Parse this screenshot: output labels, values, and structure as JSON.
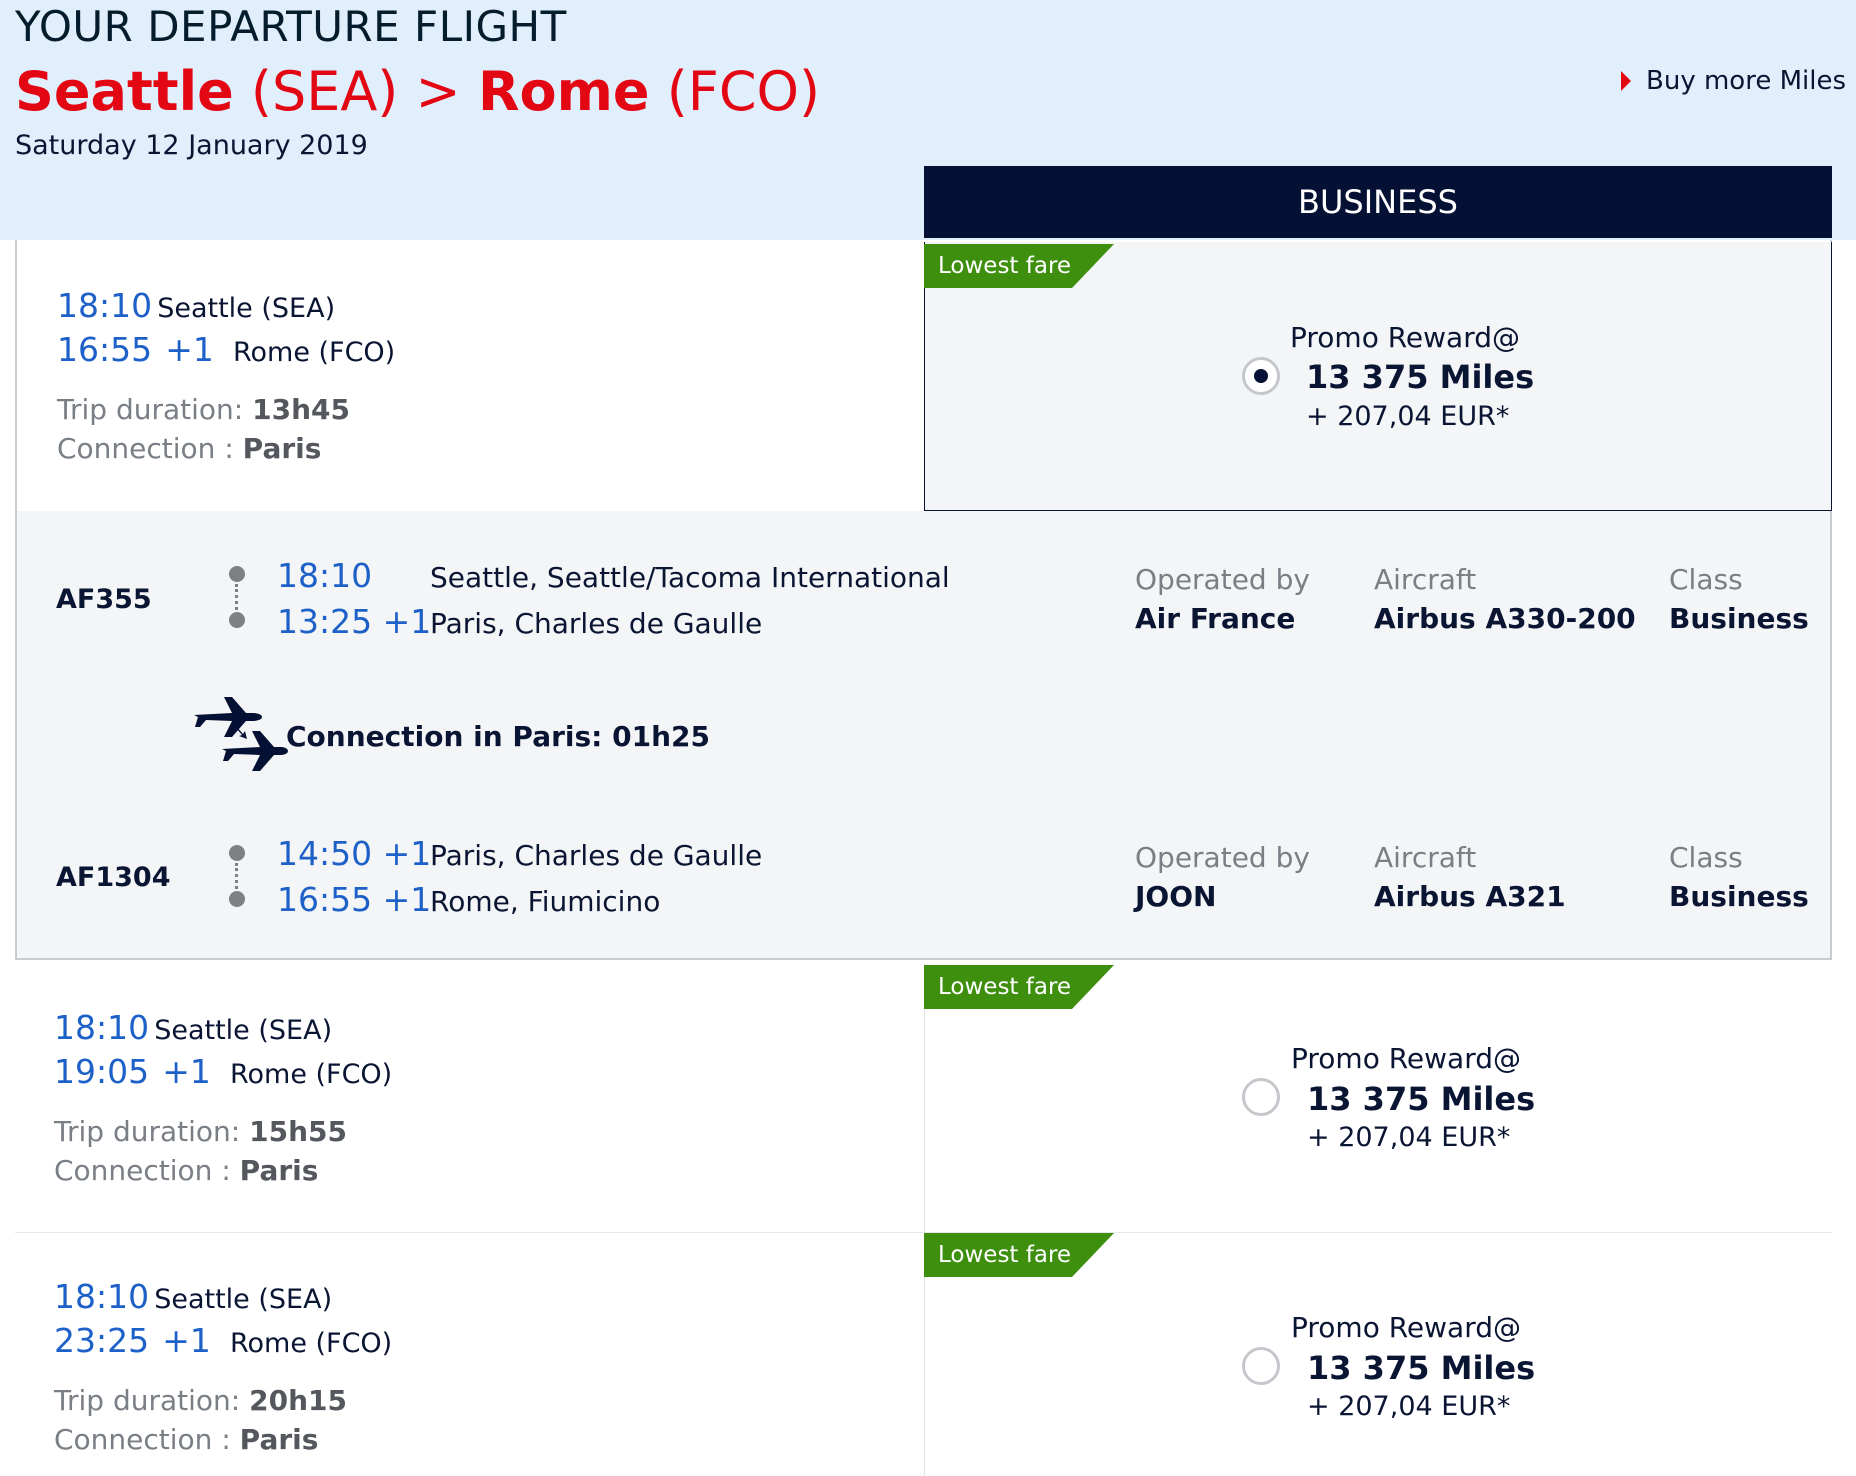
{
  "header": {
    "title": "YOUR DEPARTURE FLIGHT",
    "route": {
      "origin_city": "Seattle",
      "origin_code": "(SEA)",
      "separator": ">",
      "dest_city": "Rome",
      "dest_code": "(FCO)"
    },
    "date": "Saturday 12 January 2019",
    "buy_miles": "Buy more Miles",
    "cabin": "BUSINESS"
  },
  "colors": {
    "header_bg": "#e1effc",
    "route_red": "#e30613",
    "navy": "#051134",
    "time_blue": "#1d61c8",
    "badge_green": "#3f8f0f"
  },
  "flights": [
    {
      "dep_time": "18:10",
      "dep_city": "Seattle (SEA)",
      "arr_time": "16:55",
      "arr_offset": "+1",
      "arr_city": "Rome (FCO)",
      "duration_label": "Trip duration:",
      "duration": "13h45",
      "connection_label": "Connection :",
      "connection": "Paris",
      "badge": "Lowest fare",
      "fare_name": "Promo Reward@",
      "miles": "13 375 Miles",
      "price": "+ 207,04 EUR*",
      "selected": true,
      "segments": [
        {
          "flight_no": "AF355",
          "dep_time": "18:10",
          "dep_place": "Seattle, Seattle/Tacoma International",
          "arr_time": "13:25 +1",
          "arr_place": "Paris, Charles de Gaulle",
          "operated_label": "Operated by",
          "operated": "Air France",
          "aircraft_label": "Aircraft",
          "aircraft": "Airbus A330-200",
          "class_label": "Class",
          "class": "Business"
        },
        {
          "flight_no": "AF1304",
          "dep_time": "14:50 +1",
          "dep_place": "Paris, Charles de Gaulle",
          "arr_time": "16:55 +1",
          "arr_place": "Rome, Fiumicino",
          "operated_label": "Operated by",
          "operated": "JOON",
          "aircraft_label": "Aircraft",
          "aircraft": "Airbus A321",
          "class_label": "Class",
          "class": "Business"
        }
      ],
      "connection_text": "Connection in Paris: 01h25",
      "connection_icon": "plane-connection-icon"
    },
    {
      "dep_time": "18:10",
      "dep_city": "Seattle (SEA)",
      "arr_time": "19:05",
      "arr_offset": "+1",
      "arr_city": "Rome (FCO)",
      "duration_label": "Trip duration:",
      "duration": "15h55",
      "connection_label": "Connection :",
      "connection": "Paris",
      "badge": "Lowest fare",
      "fare_name": "Promo Reward@",
      "miles": "13 375 Miles",
      "price": "+ 207,04 EUR*",
      "selected": false
    },
    {
      "dep_time": "18:10",
      "dep_city": "Seattle (SEA)",
      "arr_time": "23:25",
      "arr_offset": "+1",
      "arr_city": "Rome (FCO)",
      "duration_label": "Trip duration:",
      "duration": "20h15",
      "connection_label": "Connection :",
      "connection": "Paris",
      "badge": "Lowest fare",
      "fare_name": "Promo Reward@",
      "miles": "13 375 Miles",
      "price": "+ 207,04 EUR*",
      "selected": false
    }
  ]
}
